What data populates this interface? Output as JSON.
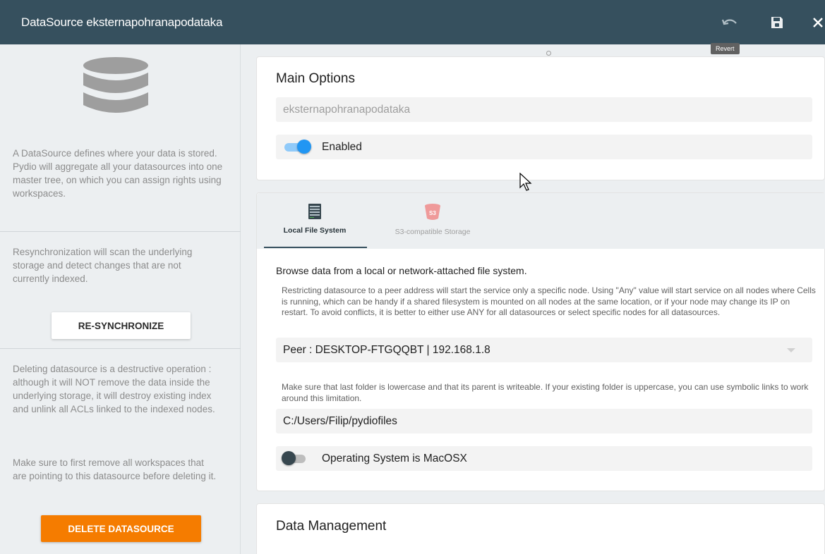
{
  "window": {
    "title": "DataSource eksternapohranapodataka",
    "revert_tooltip": "Revert",
    "icons": [
      "undo-icon",
      "save-icon",
      "close-icon"
    ]
  },
  "sidebar": {
    "description": "A DataSource defines where your data is stored. Pydio will aggregate all your datasources into one master tree, on which you can assign rights using workspaces.",
    "resync_text": "Resynchronization will scan the underlying storage and detect changes that are not currently indexed.",
    "resync_button": "RE-SYNCHRONIZE",
    "delete_text_1": "Deleting datasource is a destructive operation : although it will NOT remove the data inside the underlying storage, it will destroy existing index and unlink all ACLs linked to the indexed nodes.",
    "delete_text_2": "Make sure to first remove all workspaces that are pointing to this datasource before deleting it.",
    "delete_button": "DELETE DATASOURCE"
  },
  "main_options": {
    "title": "Main Options",
    "name_value": "eksternapohranapodataka",
    "enabled_label": "Enabled",
    "enabled": true
  },
  "storage": {
    "tabs": [
      {
        "label": "Local File System",
        "icon": "server-icon",
        "active": true
      },
      {
        "label": "S3-compatible Storage",
        "icon": "s3-bucket-icon",
        "active": false
      }
    ],
    "heading": "Browse data from a local or network-attached file system.",
    "peer_help": "Restricting datasource to a peer address will start the service only a specific node. Using \"Any\" value will start service on all nodes where Cells is running, which can be handy if a shared filesystem is mounted on all nodes at the same location, or if your node may change its IP on restart. To avoid conflicts, it is better to either use ANY for all datasources or select specific nodes for all datasources.",
    "peer_value": "Peer : DESKTOP-FTGQQBT | 192.168.1.8",
    "folder_help": "Make sure that last folder is lowercase and that its parent is writeable. If your existing folder is uppercase, you can use symbolic links to work around this limitation.",
    "folder_value": "C:/Users/Filip/pydiofiles",
    "macos_label": "Operating System is MacOSX",
    "macos": false
  },
  "data_management": {
    "title": "Data Management"
  },
  "colors": {
    "titlebar": "#36505e",
    "accent": "#2196f3",
    "danger": "#f57c00"
  }
}
